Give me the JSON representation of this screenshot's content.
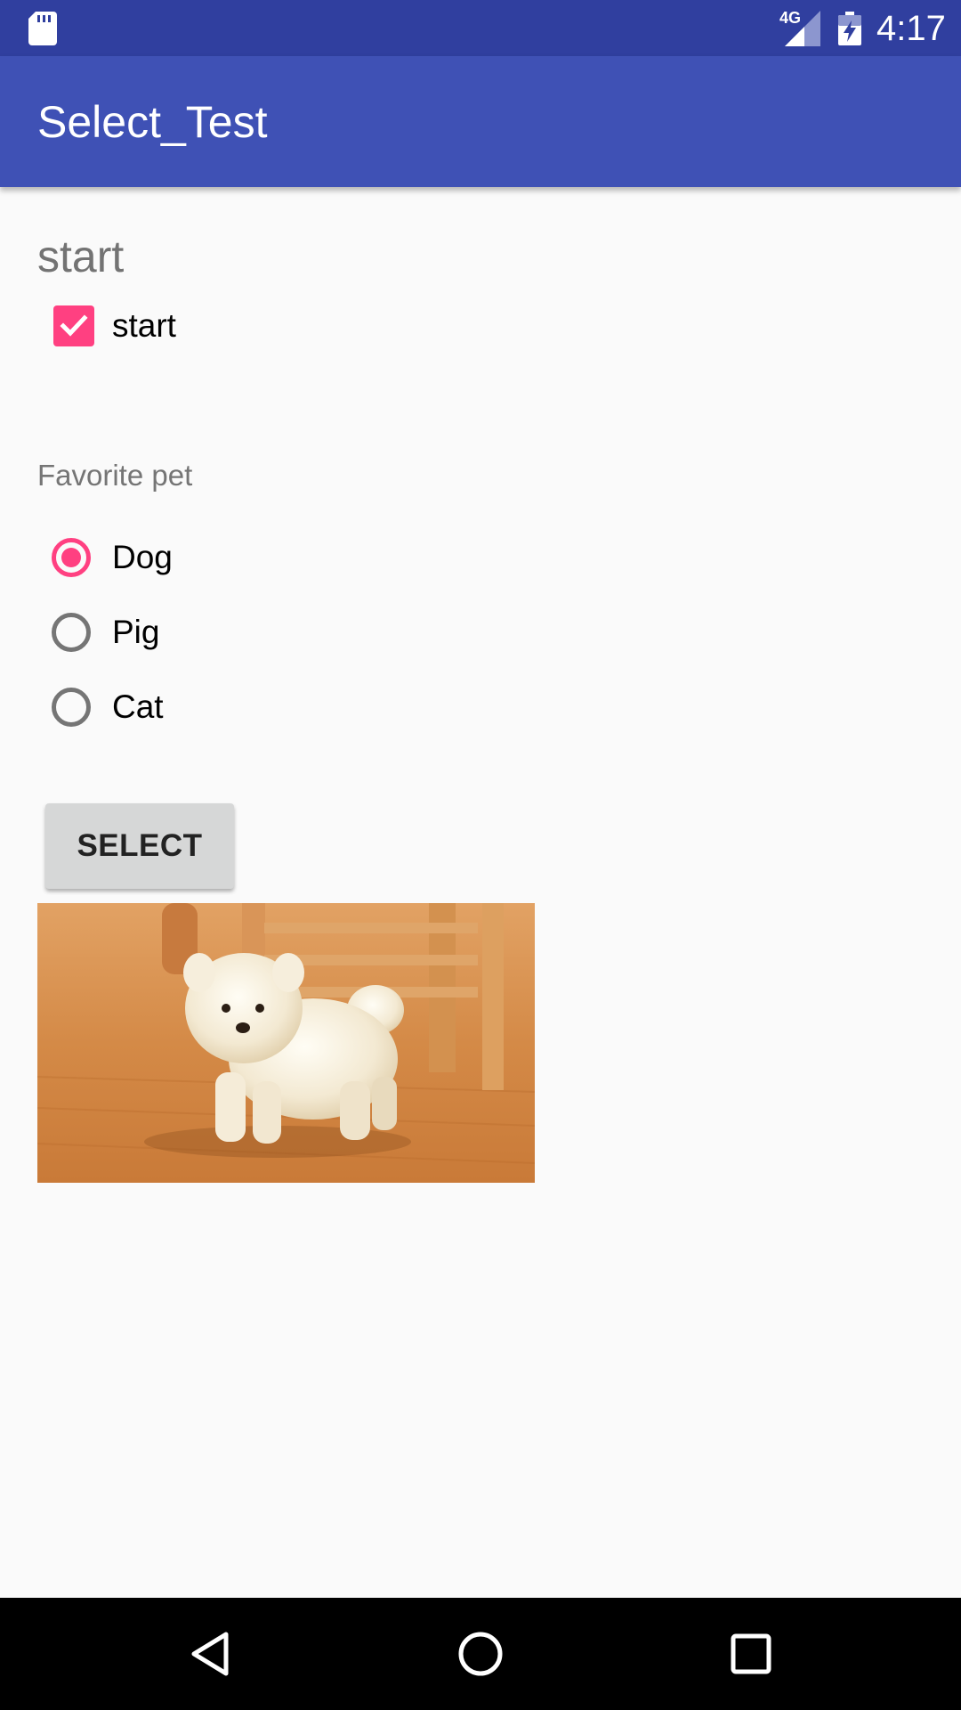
{
  "status_bar": {
    "network_label": "4G",
    "time": "4:17"
  },
  "app_bar": {
    "title": "Select_Test"
  },
  "content": {
    "section_title": "start",
    "checkbox": {
      "label": "start",
      "checked": true
    },
    "radio_group": {
      "label": "Favorite pet",
      "options": [
        {
          "label": "Dog",
          "checked": true
        },
        {
          "label": "Pig",
          "checked": false
        },
        {
          "label": "Cat",
          "checked": false
        }
      ]
    },
    "select_button": {
      "label": "SELECT"
    },
    "image": {
      "subject": "white puppy standing on wooden floor near a chair"
    }
  },
  "nav_bar": {
    "icons": [
      "back-icon",
      "home-icon",
      "recents-icon"
    ]
  },
  "colors": {
    "status_bar": "#303F9F",
    "app_bar": "#3F51B5",
    "accent": "#FF4081",
    "background": "#FAFAFA",
    "nav_bar": "#000000"
  }
}
